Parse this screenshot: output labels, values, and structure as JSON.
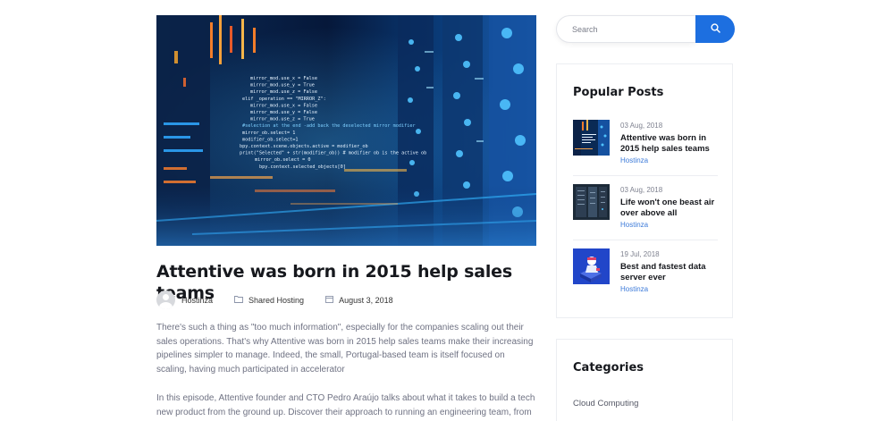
{
  "post": {
    "title": "Attentive was born in 2015 help sales teams",
    "author": "Hostinza",
    "category": "Shared Hosting",
    "date": "August 3, 2018",
    "paragraphs": [
      "There's such a thing as \"too much information\", especially for the companies scaling out their sales operations. That's why Attentive was born in 2015 help sales teams make their increasing pipelines simpler to manage. Indeed, the small, Portugal-based team is itself focused on scaling, having much participated in accelerator",
      "In this episode, Attentive founder and CTO Pedro Araújo talks about what it takes to build a tech new product from the ground up. Discover their approach to running an engineering team, from"
    ],
    "icons": {
      "avatar": "user-avatar-icon",
      "category": "folder-icon",
      "date": "calendar-icon"
    }
  },
  "hero_code_lines": [
    "mirror_mod.use_x = False",
    "mirror_mod.use_y = True",
    "mirror_mod.use_z = False",
    "elif _operation == \"MIRROR_Z\":",
    "mirror_mod.use_x = False",
    "mirror_mod.use_y = False",
    "mirror_mod.use_z = True",
    "#selection at the end -add back the deselected mirror modifier",
    "mirror_ob.select= 1",
    "modifier_ob.select=1",
    "bpy.context.scene.objects.active = modifier_ob",
    "print(\"Selected\" + str(modifier_ob)) # modifier ob is the active ob",
    "mirror_ob.select = 0",
    "bpy.context.selected_objects[0]"
  ],
  "search": {
    "placeholder": "Search",
    "icon": "search-icon",
    "button_color": "#1d6fe0"
  },
  "sidebar": {
    "popular_title": "Popular Posts",
    "popular_posts": [
      {
        "date": "03 Aug, 2018",
        "title": "Attentive was born in 2015 help sales teams",
        "author": "Hostinza"
      },
      {
        "date": "03 Aug, 2018",
        "title": "Life won't one beast air over above all",
        "author": "Hostinza"
      },
      {
        "date": "19 Jul, 2018",
        "title": "Best and fastest data server ever",
        "author": "Hostinza"
      }
    ],
    "categories_title": "Categories",
    "categories": [
      "Cloud Computing"
    ]
  },
  "colors": {
    "accent": "#1d6fe0",
    "link": "#3d7bd9",
    "heading": "#16181d",
    "body_text": "#6f7283"
  }
}
